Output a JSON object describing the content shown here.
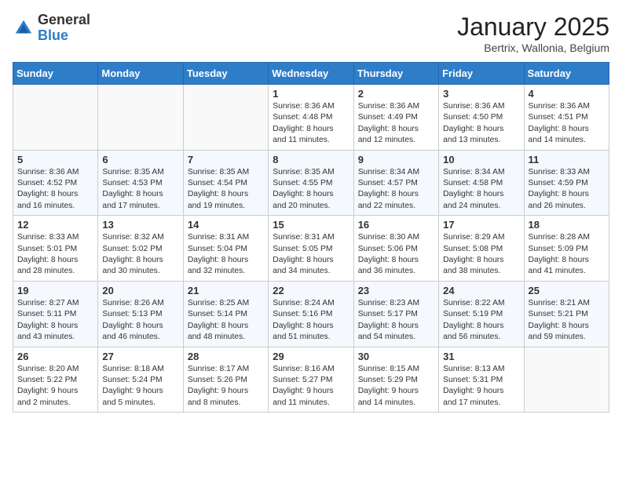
{
  "header": {
    "logo_general": "General",
    "logo_blue": "Blue",
    "month_title": "January 2025",
    "location": "Bertrix, Wallonia, Belgium"
  },
  "days_of_week": [
    "Sunday",
    "Monday",
    "Tuesday",
    "Wednesday",
    "Thursday",
    "Friday",
    "Saturday"
  ],
  "weeks": [
    [
      {
        "day": "",
        "info": ""
      },
      {
        "day": "",
        "info": ""
      },
      {
        "day": "",
        "info": ""
      },
      {
        "day": "1",
        "info": "Sunrise: 8:36 AM\nSunset: 4:48 PM\nDaylight: 8 hours\nand 11 minutes."
      },
      {
        "day": "2",
        "info": "Sunrise: 8:36 AM\nSunset: 4:49 PM\nDaylight: 8 hours\nand 12 minutes."
      },
      {
        "day": "3",
        "info": "Sunrise: 8:36 AM\nSunset: 4:50 PM\nDaylight: 8 hours\nand 13 minutes."
      },
      {
        "day": "4",
        "info": "Sunrise: 8:36 AM\nSunset: 4:51 PM\nDaylight: 8 hours\nand 14 minutes."
      }
    ],
    [
      {
        "day": "5",
        "info": "Sunrise: 8:36 AM\nSunset: 4:52 PM\nDaylight: 8 hours\nand 16 minutes."
      },
      {
        "day": "6",
        "info": "Sunrise: 8:35 AM\nSunset: 4:53 PM\nDaylight: 8 hours\nand 17 minutes."
      },
      {
        "day": "7",
        "info": "Sunrise: 8:35 AM\nSunset: 4:54 PM\nDaylight: 8 hours\nand 19 minutes."
      },
      {
        "day": "8",
        "info": "Sunrise: 8:35 AM\nSunset: 4:55 PM\nDaylight: 8 hours\nand 20 minutes."
      },
      {
        "day": "9",
        "info": "Sunrise: 8:34 AM\nSunset: 4:57 PM\nDaylight: 8 hours\nand 22 minutes."
      },
      {
        "day": "10",
        "info": "Sunrise: 8:34 AM\nSunset: 4:58 PM\nDaylight: 8 hours\nand 24 minutes."
      },
      {
        "day": "11",
        "info": "Sunrise: 8:33 AM\nSunset: 4:59 PM\nDaylight: 8 hours\nand 26 minutes."
      }
    ],
    [
      {
        "day": "12",
        "info": "Sunrise: 8:33 AM\nSunset: 5:01 PM\nDaylight: 8 hours\nand 28 minutes."
      },
      {
        "day": "13",
        "info": "Sunrise: 8:32 AM\nSunset: 5:02 PM\nDaylight: 8 hours\nand 30 minutes."
      },
      {
        "day": "14",
        "info": "Sunrise: 8:31 AM\nSunset: 5:04 PM\nDaylight: 8 hours\nand 32 minutes."
      },
      {
        "day": "15",
        "info": "Sunrise: 8:31 AM\nSunset: 5:05 PM\nDaylight: 8 hours\nand 34 minutes."
      },
      {
        "day": "16",
        "info": "Sunrise: 8:30 AM\nSunset: 5:06 PM\nDaylight: 8 hours\nand 36 minutes."
      },
      {
        "day": "17",
        "info": "Sunrise: 8:29 AM\nSunset: 5:08 PM\nDaylight: 8 hours\nand 38 minutes."
      },
      {
        "day": "18",
        "info": "Sunrise: 8:28 AM\nSunset: 5:09 PM\nDaylight: 8 hours\nand 41 minutes."
      }
    ],
    [
      {
        "day": "19",
        "info": "Sunrise: 8:27 AM\nSunset: 5:11 PM\nDaylight: 8 hours\nand 43 minutes."
      },
      {
        "day": "20",
        "info": "Sunrise: 8:26 AM\nSunset: 5:13 PM\nDaylight: 8 hours\nand 46 minutes."
      },
      {
        "day": "21",
        "info": "Sunrise: 8:25 AM\nSunset: 5:14 PM\nDaylight: 8 hours\nand 48 minutes."
      },
      {
        "day": "22",
        "info": "Sunrise: 8:24 AM\nSunset: 5:16 PM\nDaylight: 8 hours\nand 51 minutes."
      },
      {
        "day": "23",
        "info": "Sunrise: 8:23 AM\nSunset: 5:17 PM\nDaylight: 8 hours\nand 54 minutes."
      },
      {
        "day": "24",
        "info": "Sunrise: 8:22 AM\nSunset: 5:19 PM\nDaylight: 8 hours\nand 56 minutes."
      },
      {
        "day": "25",
        "info": "Sunrise: 8:21 AM\nSunset: 5:21 PM\nDaylight: 8 hours\nand 59 minutes."
      }
    ],
    [
      {
        "day": "26",
        "info": "Sunrise: 8:20 AM\nSunset: 5:22 PM\nDaylight: 9 hours\nand 2 minutes."
      },
      {
        "day": "27",
        "info": "Sunrise: 8:18 AM\nSunset: 5:24 PM\nDaylight: 9 hours\nand 5 minutes."
      },
      {
        "day": "28",
        "info": "Sunrise: 8:17 AM\nSunset: 5:26 PM\nDaylight: 9 hours\nand 8 minutes."
      },
      {
        "day": "29",
        "info": "Sunrise: 8:16 AM\nSunset: 5:27 PM\nDaylight: 9 hours\nand 11 minutes."
      },
      {
        "day": "30",
        "info": "Sunrise: 8:15 AM\nSunset: 5:29 PM\nDaylight: 9 hours\nand 14 minutes."
      },
      {
        "day": "31",
        "info": "Sunrise: 8:13 AM\nSunset: 5:31 PM\nDaylight: 9 hours\nand 17 minutes."
      },
      {
        "day": "",
        "info": ""
      }
    ]
  ]
}
